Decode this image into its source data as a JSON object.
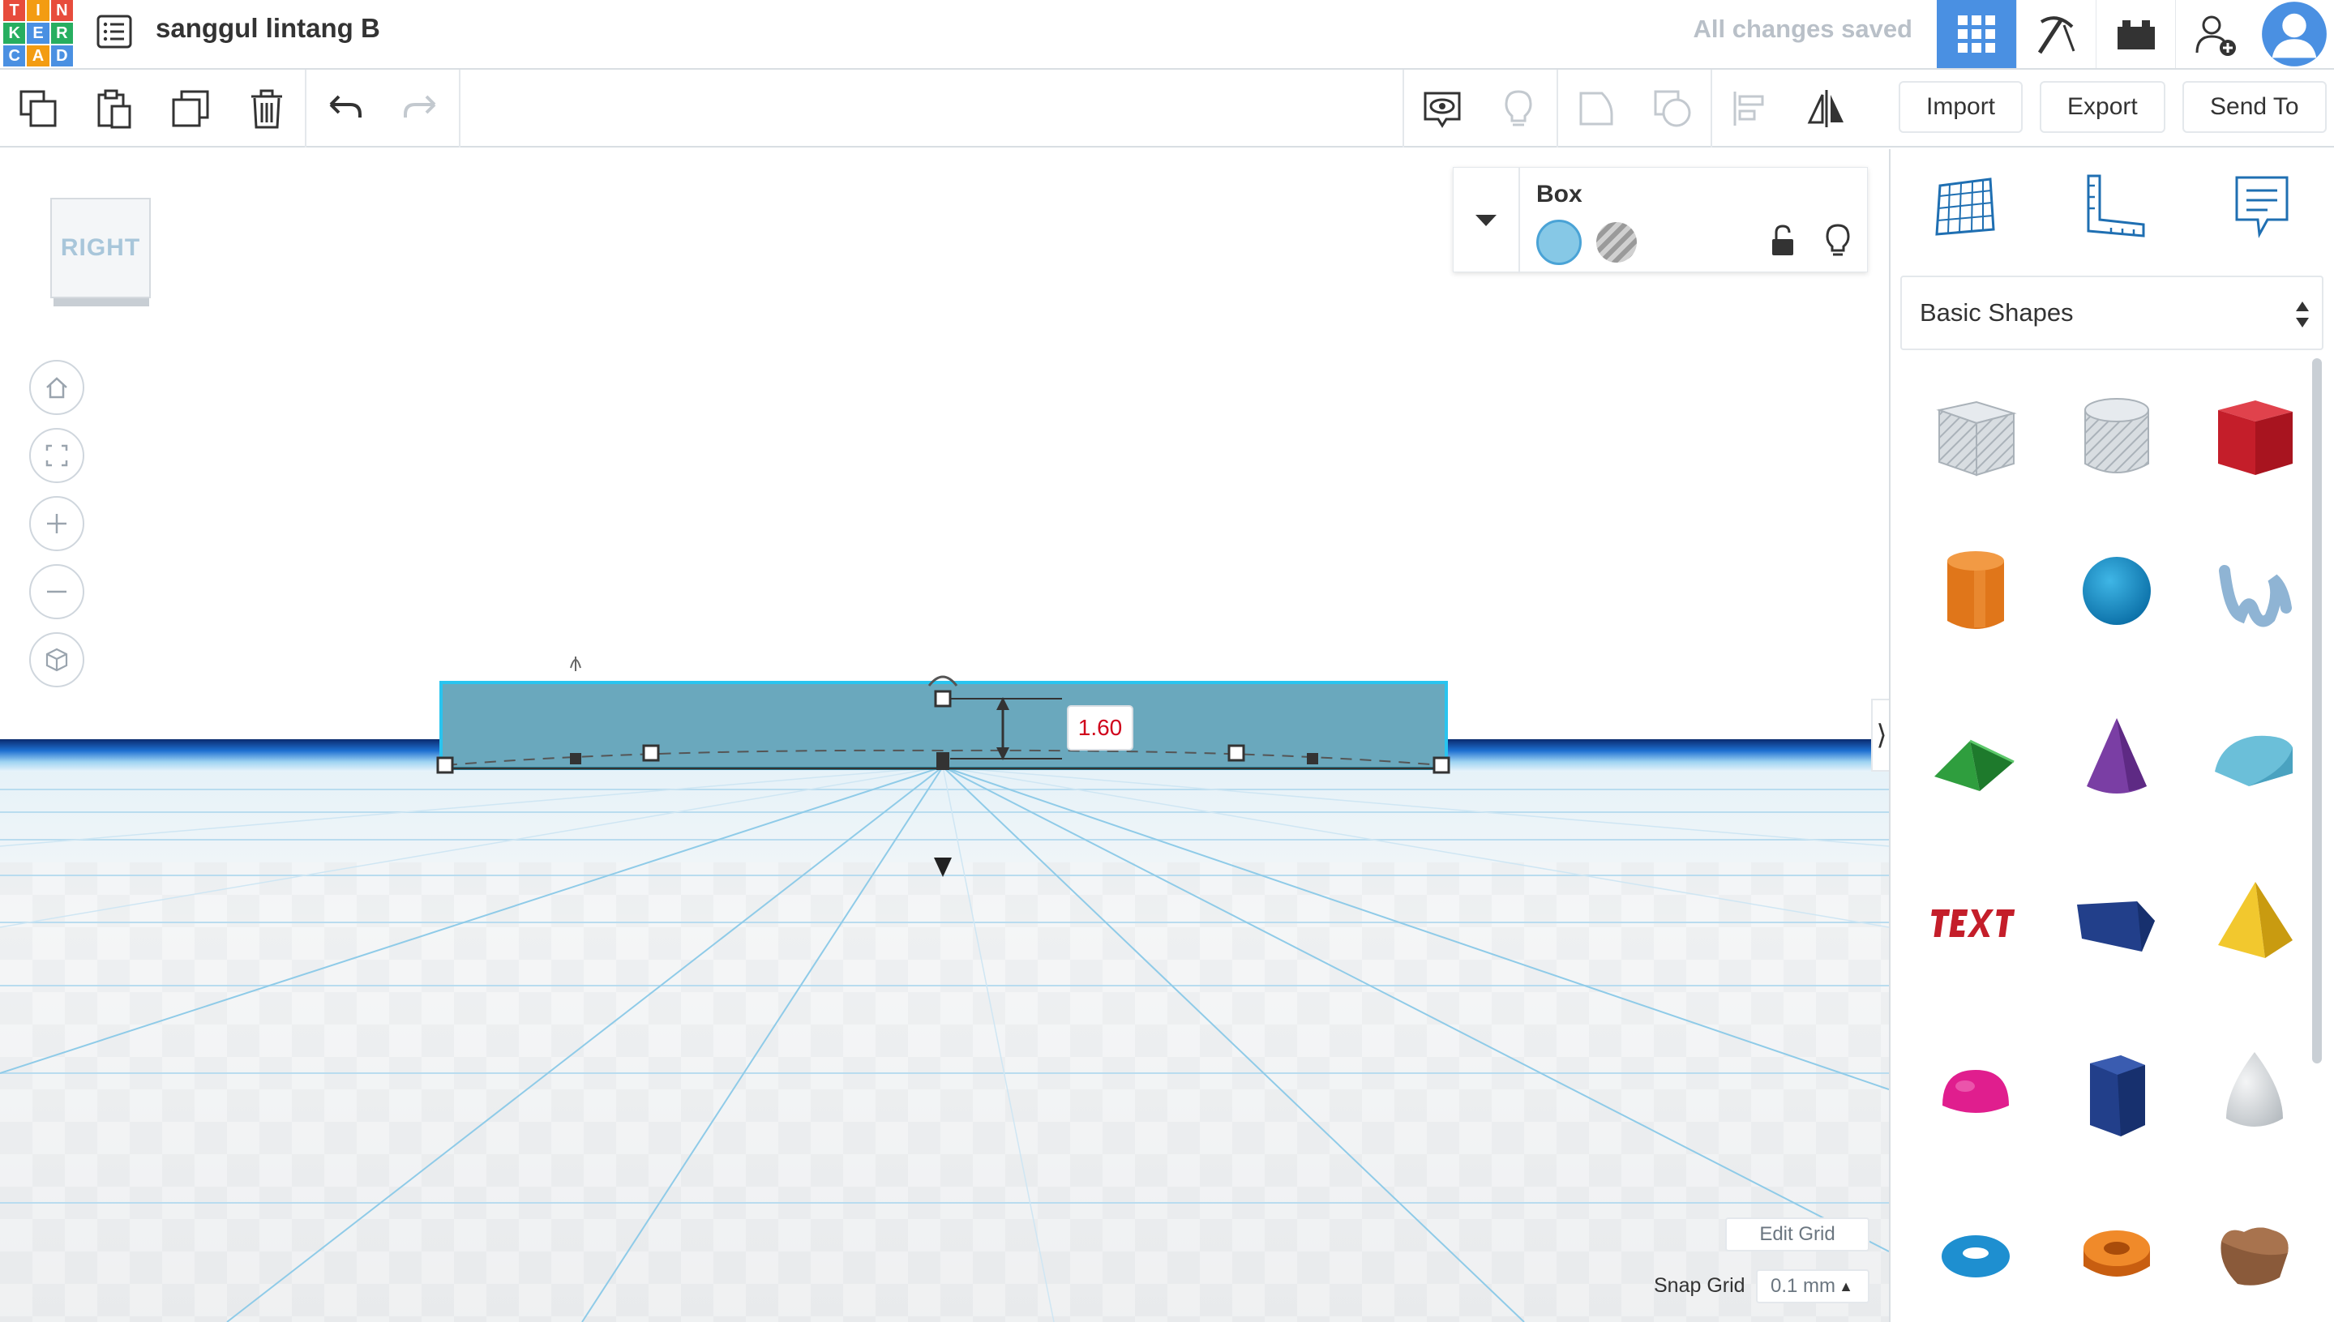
{
  "app": {
    "logo_letters": [
      "T",
      "I",
      "N",
      "K",
      "E",
      "R",
      "C",
      "A",
      "D"
    ],
    "logo_colors": [
      "#e74c3c",
      "#f39c12",
      "#e74c3c",
      "#27ae60",
      "#4a90e2",
      "#27ae60",
      "#4a90e2",
      "#f39c12",
      "#4a90e2"
    ],
    "document_title": "sanggul lintang B",
    "save_status": "All changes saved"
  },
  "topbar_icons": [
    "grid-view-icon",
    "pickaxe-icon",
    "bricks-icon",
    "add-user-icon",
    "avatar"
  ],
  "toolbar": {
    "import_label": "Import",
    "export_label": "Export",
    "send_to_label": "Send To"
  },
  "viewcube": {
    "face_label": "RIGHT"
  },
  "inspector": {
    "shape_name": "Box",
    "solid_color": "#86c8e6",
    "hole_color": "#a0a0a0"
  },
  "selection": {
    "height_value": "1.60"
  },
  "grid": {
    "edit_label": "Edit Grid",
    "snap_label": "Snap Grid",
    "snap_value": "0.1 mm"
  },
  "panel": {
    "category": "Basic Shapes",
    "shapes": [
      "Box Hole",
      "Cylinder Hole",
      "Box",
      "Cylinder",
      "Sphere",
      "Scribble",
      "Roof",
      "Cone",
      "Round Roof",
      "Text",
      "Wedge",
      "Pyramid",
      "Half Sphere",
      "Polygon",
      "Paraboloid",
      "Torus",
      "Tube",
      "Heart"
    ]
  },
  "colors": {
    "accent": "#4a90e2",
    "selection_fill": "#6aa8bd",
    "selection_outline": "#29c4ef",
    "dimension_text": "#d0021b"
  }
}
